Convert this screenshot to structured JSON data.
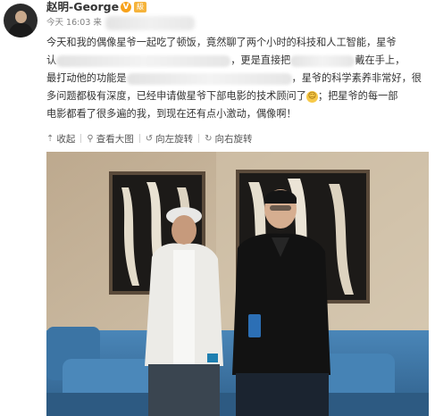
{
  "post": {
    "username": "赵明-George",
    "verified_badge": "V",
    "level_badge": "級",
    "time": "今天 16:03 来",
    "content": {
      "line1": "今天和我的偶像星爷一起吃了顿饭，竟然聊了两个小时的科技和人工智能，星爷",
      "line2a": "认",
      "line2b": "，更是直接把",
      "line2c": "戴在手上，",
      "line3a": "最打动他的功能是",
      "line3b": "，星爷的科学素养非常好，很",
      "line4a": "多问题都极有深度，已经申请做星爷下部电影的技术顾问了",
      "line4b": "；把星爷的每一部",
      "line5": "电影都看了很多遍的我，到现在还有点小激动，偶像啊！"
    }
  },
  "toolbar": {
    "collect": "收起",
    "view_large": "查看大图",
    "rotate_left": "向左旋转",
    "rotate_right": "向右旋转"
  },
  "icons": {
    "collect": "arrow-up-icon",
    "view_large": "magnifier-icon",
    "rotate_left": "rotate-left-icon",
    "rotate_right": "rotate-right-icon"
  },
  "colors": {
    "username": "#333333",
    "time": "#808080",
    "verified": "#f7a21b",
    "sofa": "#3f78a8"
  }
}
